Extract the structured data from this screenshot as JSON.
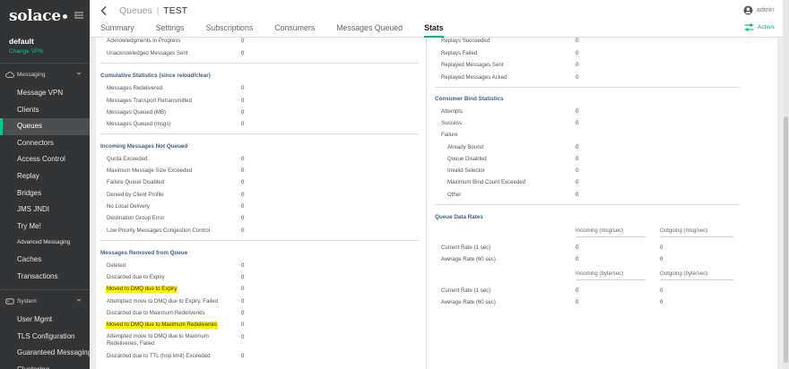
{
  "sidebar": {
    "logo": "solace",
    "vpn_name": "default",
    "vpn_change": "Change VPN",
    "groups": {
      "messaging": "Messaging",
      "system": "System"
    },
    "messaging_items": [
      "Message VPN",
      "Clients",
      "Queues",
      "Connectors",
      "Access Control",
      "Replay",
      "Bridges",
      "JMS JNDI",
      "Try Me!",
      "Advanced Messaging",
      "Caches",
      "Transactions"
    ],
    "system_items": [
      "User Mgmt",
      "TLS Configuration",
      "Guaranteed Messaging",
      "Clustering"
    ]
  },
  "header": {
    "breadcrumb": "Queues",
    "separator": "|",
    "name": "TEST",
    "user": "admin",
    "action": "Action",
    "tabs": [
      "Summary",
      "Settings",
      "Subscriptions",
      "Consumers",
      "Messages Queued",
      "Stats"
    ]
  },
  "left": {
    "top_rows": [
      {
        "label": "Acknowledgments In Progress",
        "value": "0"
      },
      {
        "label": "Unacknowledged Messages Sent",
        "value": "0"
      }
    ],
    "cumulative": {
      "title": "Cumulative Statistics (since reload/clear)",
      "rows": [
        {
          "label": "Messages Redelivered",
          "value": "0"
        },
        {
          "label": "Messages Transport Retransmitted",
          "value": "0"
        },
        {
          "label": "Messages Queued (MB)",
          "value": "0"
        },
        {
          "label": "Messages Queued (msgs)",
          "value": "0"
        }
      ]
    },
    "incoming_not_queued": {
      "title": "Incoming Messages Not Queued",
      "rows": [
        {
          "label": "Quota Exceeded",
          "value": "0"
        },
        {
          "label": "Maximum Message Size Exceeded",
          "value": "0"
        },
        {
          "label": "Failure Queue Disabled",
          "value": "0"
        },
        {
          "label": "Denied by Client Profile",
          "value": "0"
        },
        {
          "label": "No Local Delivery",
          "value": "0"
        },
        {
          "label": "Destination Group Error",
          "value": "0"
        },
        {
          "label": "Low Priority Messages Congestion Control",
          "value": "0"
        }
      ]
    },
    "removed": {
      "title": "Messages Removed from Queue",
      "rows": [
        {
          "label": "Deleted",
          "value": "0"
        },
        {
          "label": "Discarded due to Expiry",
          "value": "0"
        },
        {
          "label": "Moved to DMQ due to Expiry",
          "value": "0"
        },
        {
          "label": "Attempted move to DMQ due to Expiry, Failed",
          "value": "0"
        },
        {
          "label": "Discarded due to Maximum Redeliveries",
          "value": "0"
        },
        {
          "label": "Moved to DMQ due to Maximum Redeliveries",
          "value": "0"
        },
        {
          "label": "Attempted move to DMQ due to Maximum Redeliveries, Failed",
          "value": "0"
        },
        {
          "label": "Discarded due to TTL (hop limit) Exceeded",
          "value": "0"
        }
      ]
    }
  },
  "right": {
    "replay_rows": [
      {
        "label": "Replays Succeeded",
        "value": "0"
      },
      {
        "label": "Replays Failed",
        "value": "0"
      },
      {
        "label": "Replayed Messages Sent",
        "value": "0"
      },
      {
        "label": "Replayed Messages Acked",
        "value": "0"
      }
    ],
    "consumer_bind": {
      "title": "Consumer Bind Statistics",
      "rows": [
        {
          "label": "Attempts",
          "value": "0"
        },
        {
          "label": "Success",
          "value": "0"
        },
        {
          "label": "Failure",
          "value": ""
        },
        {
          "label": "Already Bound",
          "value": "0"
        },
        {
          "label": "Queue Disabled",
          "value": "0"
        },
        {
          "label": "Invalid Selector",
          "value": "0"
        },
        {
          "label": "Maximum Bind Count Exceeded",
          "value": "0"
        },
        {
          "label": "Other",
          "value": "0"
        }
      ]
    },
    "rates": {
      "title": "Queue Data Rates",
      "msg_headers": [
        "Incoming (msg/sec)",
        "Outgoing (msg/sec)"
      ],
      "msg_rows": [
        {
          "label": "Current Rate (1 sec)",
          "in": "0",
          "out": "0"
        },
        {
          "label": "Average Rate (60 sec)",
          "in": "0",
          "out": "0"
        }
      ],
      "byte_headers": [
        "Incoming (byte/sec)",
        "Outgoing (byte/sec)"
      ],
      "byte_rows": [
        {
          "label": "Current Rate (1 sec)",
          "in": "0",
          "out": "0"
        },
        {
          "label": "Average Rate (60 sec)",
          "in": "0",
          "out": "0"
        }
      ]
    }
  }
}
